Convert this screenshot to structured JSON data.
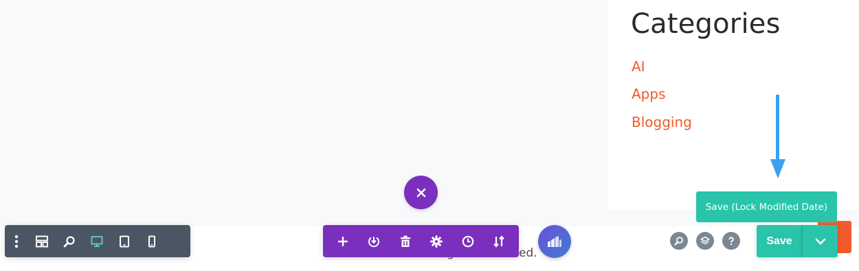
{
  "sidebar": {
    "title": "Categories",
    "categories": [
      "AI",
      "Apps",
      "Blogging"
    ]
  },
  "footer_partial_text_left": "g",
  "footer_partial_text_right": "ed.",
  "builder": {
    "save_label": "Save",
    "save_lock_label": "Save (Lock Modified Date)",
    "left_toolbar_icons": [
      "more-vertical-icon",
      "wireframe-icon",
      "zoom-icon",
      "desktop-icon",
      "tablet-icon",
      "phone-icon"
    ],
    "section_toolbar_icons": [
      "add-icon",
      "portability-icon",
      "trash-icon",
      "settings-icon",
      "history-icon",
      "sort-icon"
    ],
    "right_icons": [
      "search-icon",
      "layers-icon",
      "help-icon"
    ]
  },
  "colors": {
    "accent_orange": "#f15a2b",
    "builder_purple": "#7b2fbe",
    "toolbar_gray": "#4b5664",
    "save_green": "#29c4a9",
    "active_view_green": "#5bc8b0",
    "arrow_blue": "#3aa0f0"
  }
}
